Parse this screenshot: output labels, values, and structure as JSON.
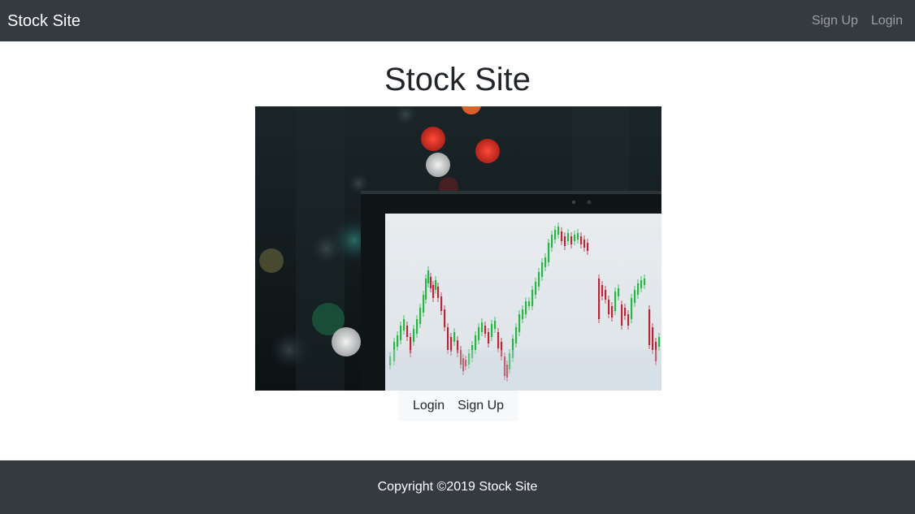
{
  "navbar": {
    "brand": "Stock Site",
    "links": [
      "Sign Up",
      "Login"
    ]
  },
  "main": {
    "title": "Stock Site",
    "hero_image": "laptop-stock-chart-photo",
    "buttons": {
      "login": "Login",
      "signup": "Sign Up"
    }
  },
  "footer": {
    "copyright": "Copyright ©2019 Stock Site"
  },
  "colors": {
    "navbar_bg": "#343a40",
    "footer_bg": "#343a40",
    "button_bg": "#f8f9fa",
    "candle_up": "#2bb34a",
    "candle_down": "#b22a3a"
  }
}
